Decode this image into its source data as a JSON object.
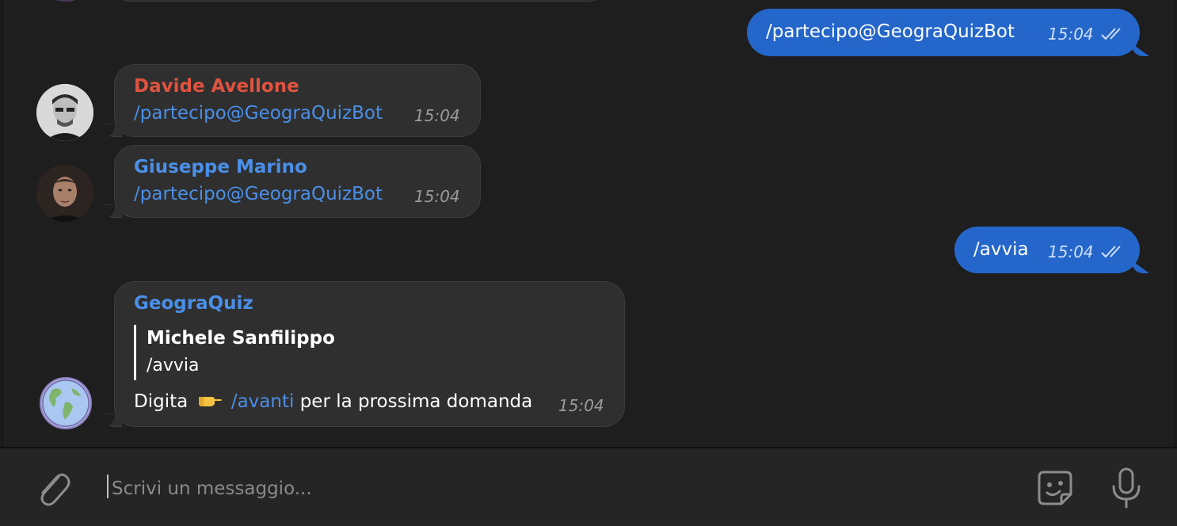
{
  "messages": {
    "outgoing_1": {
      "text": "/partecipo@GeograQuizBot",
      "time": "15:04"
    },
    "davide": {
      "sender": "Davide Avellone",
      "sender_color": "#e0533f",
      "text": "/partecipo@GeograQuizBot",
      "time": "15:04"
    },
    "giuseppe": {
      "sender": "Giuseppe Marino",
      "sender_color": "#4a8fe8",
      "text": "/partecipo@GeograQuizBot",
      "time": "15:04"
    },
    "outgoing_2": {
      "text": "/avvia",
      "time": "15:04"
    },
    "geograquiz": {
      "sender": "GeograQuiz",
      "reply_to_name": "Michele Sanfilippo",
      "reply_to_text": "/avvia",
      "text_before": "Digita",
      "emoji": "pointing-right-emoji",
      "link": "/avanti",
      "text_after": "per la prossima domanda",
      "time": "15:04"
    }
  },
  "composer": {
    "placeholder": "Scrivi un messaggio..."
  },
  "colors": {
    "outgoing_bubble": "#2466c9",
    "incoming_bubble": "#2f2f2f",
    "link": "#4a8fe8",
    "background": "#1e1e1e"
  }
}
